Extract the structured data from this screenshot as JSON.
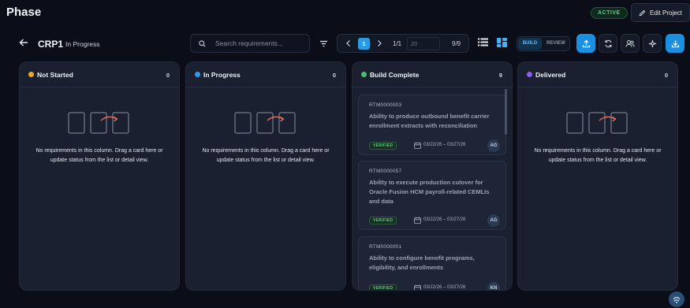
{
  "app": {
    "title": "Phase",
    "status_badge": "ACTIVE",
    "edit_label": "Edit Project"
  },
  "toolbar": {
    "crp_name": "CRP1",
    "crp_status": "In Progress",
    "search_placeholder": "Search requirements...",
    "pager": {
      "current_page": "1",
      "page_count": "1/1",
      "page_size": "20",
      "item_range": "9/9"
    },
    "mode_build": "BUILD",
    "mode_review": "REVIEW",
    "active_mode": "BUILD"
  },
  "columns": [
    {
      "title": "Not Started",
      "count": "0",
      "color": "#f5a623",
      "empty_message": "No requirements in this column. Drag a card here or update status from the list or detail view."
    },
    {
      "title": "In Progress",
      "count": "0",
      "color": "#2e9bf0",
      "empty_message": "No requirements in this column. Drag a card here or update status from the list or detail view."
    },
    {
      "title": "Build Complete",
      "count": "9",
      "color": "#45c26b",
      "cards": [
        {
          "id": "RTM0000003",
          "title": "Ability to produce outbound benefit carrier enrollment extracts with reconciliation",
          "badge": "VERIFIED",
          "dates": "03/22/26 – 03/27/26",
          "assignee": "AG"
        },
        {
          "id": "RTM0000057",
          "title": "Ability to execute production cutover for Oracle Fusion HCM payroll-related CEMLIs and data",
          "badge": "VERIFIED",
          "dates": "03/22/26 – 03/27/26",
          "assignee": "AG"
        },
        {
          "id": "RTM0000001",
          "title": "Ability to configure benefit programs, eligibility, and enrollments",
          "badge": "VERIFIED",
          "dates": "03/22/26 – 03/27/26",
          "assignee": "KN"
        }
      ]
    },
    {
      "title": "Delivered",
      "count": "0",
      "color": "#8e5cf0",
      "empty_message": "No requirements in this column. Drag a card here or update status from the list or detail view."
    }
  ],
  "colors": {
    "accent": "#1d8fe0",
    "verified": "#5cc488",
    "background": "#0b0e18",
    "column": "#1a2030"
  },
  "icons": [
    "back-arrow-icon",
    "search-icon",
    "filter-icon",
    "list-view-icon",
    "board-view-icon",
    "upload-icon",
    "sync-icon",
    "users-icon",
    "sparkle-icon",
    "download-icon",
    "calendar-icon",
    "help-icon"
  ]
}
